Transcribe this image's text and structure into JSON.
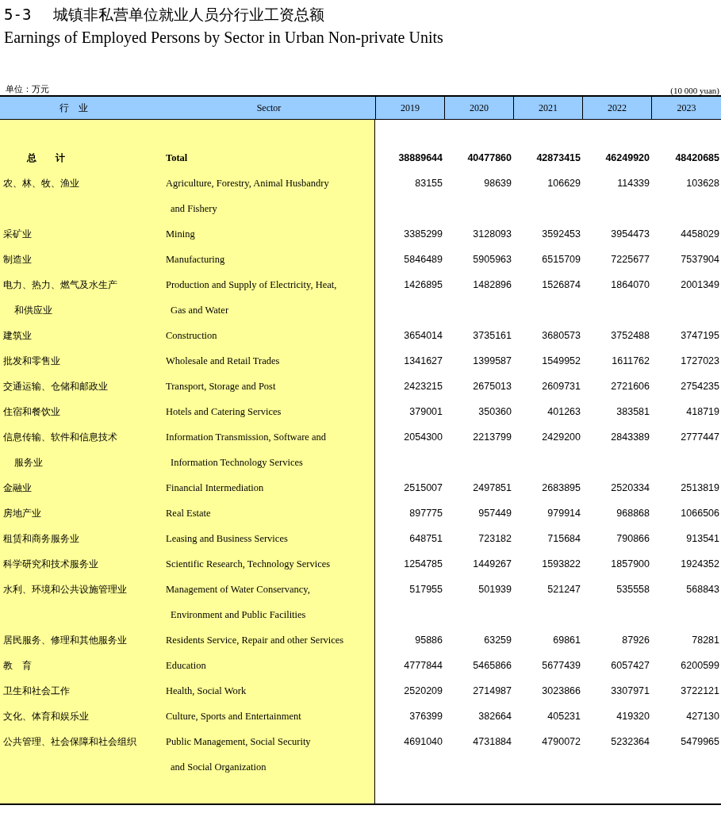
{
  "title": {
    "number": "5-3",
    "cn": "城镇非私营单位就业人员分行业工资总额",
    "en": "Earnings of Employed Persons by Sector in Urban Non-private Units"
  },
  "unit": {
    "cn": "单位：万元",
    "en": "(10 000 yuan)"
  },
  "table": {
    "columns": [
      "行　业",
      "Sector",
      "2019",
      "2020",
      "2021",
      "2022",
      "2023"
    ],
    "rows": [
      {
        "kind": "total",
        "cn": [
          "总　　计"
        ],
        "en": [
          "Total"
        ],
        "values": [
          "38889644",
          "40477860",
          "42873415",
          "46249920",
          "48420685"
        ]
      },
      {
        "kind": "sector",
        "cn": [
          "农、林、牧、渔业"
        ],
        "en": [
          "Agriculture, Forestry, Animal Husbandry",
          "and Fishery"
        ],
        "values": [
          "83155",
          "98639",
          "106629",
          "114339",
          "103628"
        ]
      },
      {
        "kind": "sector",
        "cn": [
          "采矿业"
        ],
        "en": [
          "Mining"
        ],
        "values": [
          "3385299",
          "3128093",
          "3592453",
          "3954473",
          "4458029"
        ]
      },
      {
        "kind": "sector",
        "cn": [
          "制造业"
        ],
        "en": [
          "Manufacturing"
        ],
        "values": [
          "5846489",
          "5905963",
          "6515709",
          "7225677",
          "7537904"
        ]
      },
      {
        "kind": "sector",
        "cn": [
          "电力、热力、燃气及水生产",
          "和供应业"
        ],
        "en": [
          "Production and Supply of  Electricity, Heat,",
          "Gas and Water"
        ],
        "values": [
          "1426895",
          "1482896",
          "1526874",
          "1864070",
          "2001349"
        ]
      },
      {
        "kind": "sector",
        "cn": [
          "建筑业"
        ],
        "en": [
          "Construction"
        ],
        "values": [
          "3654014",
          "3735161",
          "3680573",
          "3752488",
          "3747195"
        ]
      },
      {
        "kind": "sector",
        "cn": [
          "批发和零售业"
        ],
        "en": [
          "Wholesale and Retail Trades"
        ],
        "values": [
          "1341627",
          "1399587",
          "1549952",
          "1611762",
          "1727023"
        ]
      },
      {
        "kind": "sector",
        "cn": [
          "交通运输、仓储和邮政业"
        ],
        "en": [
          "Transport, Storage and Post"
        ],
        "values": [
          "2423215",
          "2675013",
          "2609731",
          "2721606",
          "2754235"
        ]
      },
      {
        "kind": "sector",
        "cn": [
          "住宿和餐饮业"
        ],
        "en": [
          "Hotels and Catering Services"
        ],
        "values": [
          "379001",
          "350360",
          "401263",
          "383581",
          "418719"
        ]
      },
      {
        "kind": "sector",
        "cn": [
          "信息传输、软件和信息技术",
          "服务业"
        ],
        "en": [
          "Information Transmission,  Software and",
          "Information Technology Services"
        ],
        "values": [
          "2054300",
          "2213799",
          "2429200",
          "2843389",
          "2777447"
        ]
      },
      {
        "kind": "sector",
        "cn": [
          "金融业"
        ],
        "en": [
          "Financial Intermediation"
        ],
        "values": [
          "2515007",
          "2497851",
          "2683895",
          "2520334",
          "2513819"
        ]
      },
      {
        "kind": "sector",
        "cn": [
          "房地产业"
        ],
        "en": [
          "Real Estate"
        ],
        "values": [
          "897775",
          "957449",
          "979914",
          "968868",
          "1066506"
        ]
      },
      {
        "kind": "sector",
        "cn": [
          "租赁和商务服务业"
        ],
        "en": [
          "Leasing and Business Services"
        ],
        "values": [
          "648751",
          "723182",
          "715684",
          "790866",
          "913541"
        ]
      },
      {
        "kind": "sector",
        "cn": [
          "科学研究和技术服务业"
        ],
        "en": [
          "Scientific Research,  Technology Services"
        ],
        "values": [
          "1254785",
          "1449267",
          "1593822",
          "1857900",
          "1924352"
        ]
      },
      {
        "kind": "sector",
        "cn": [
          "水利、环境和公共设施管理业"
        ],
        "en": [
          "Management of Water Conservancy,",
          "Environment and Public Facilities"
        ],
        "values": [
          "517955",
          "501939",
          "521247",
          "535558",
          "568843"
        ]
      },
      {
        "kind": "sector",
        "cn": [
          "居民服务、修理和其他服务业"
        ],
        "en": [
          "Residents Service, Repair and other Services"
        ],
        "values": [
          "95886",
          "63259",
          "69861",
          "87926",
          "78281"
        ]
      },
      {
        "kind": "sector",
        "cn": [
          "教　育"
        ],
        "en": [
          "Education"
        ],
        "values": [
          "4777844",
          "5465866",
          "5677439",
          "6057427",
          "6200599"
        ]
      },
      {
        "kind": "sector",
        "cn": [
          "卫生和社会工作"
        ],
        "en": [
          "Health, Social Work"
        ],
        "values": [
          "2520209",
          "2714987",
          "3023866",
          "3307971",
          "3722121"
        ]
      },
      {
        "kind": "sector",
        "cn": [
          "文化、体育和娱乐业"
        ],
        "en": [
          "Culture, Sports and Entertainment"
        ],
        "values": [
          "376399",
          "382664",
          "405231",
          "419320",
          "427130"
        ]
      },
      {
        "kind": "sector",
        "cn": [
          "公共管理、社会保障和社会组织"
        ],
        "en": [
          "Public Management, Social Security",
          "and Social Organization"
        ],
        "values": [
          "4691040",
          "4731884",
          "4790072",
          "5232364",
          "5479965"
        ]
      }
    ]
  }
}
